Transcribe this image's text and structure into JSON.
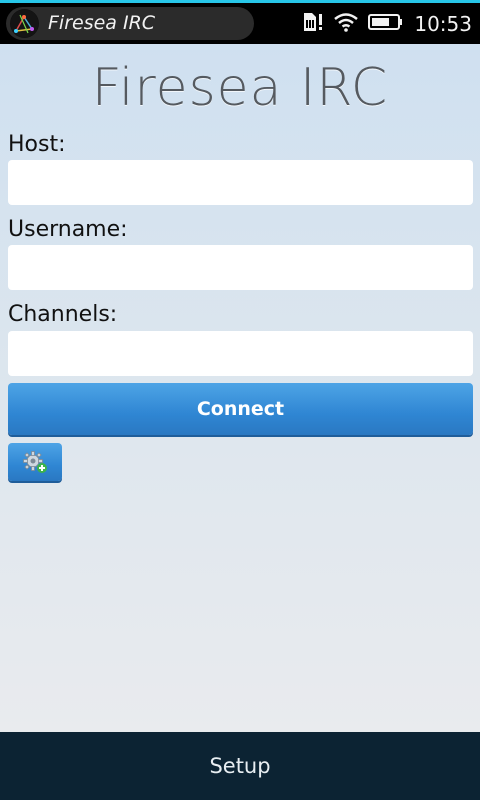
{
  "status_bar": {
    "app_title": "Firesea IRC",
    "time": "10:53",
    "icons": [
      "sim-alert-icon",
      "wifi-icon",
      "battery-icon"
    ],
    "accent_color": "#27c6e8"
  },
  "main": {
    "title": "Firesea IRC",
    "fields": [
      {
        "label": "Host:",
        "value": "",
        "placeholder": ""
      },
      {
        "label": "Username:",
        "value": "",
        "placeholder": ""
      },
      {
        "label": "Channels:",
        "value": "",
        "placeholder": ""
      }
    ],
    "connect_label": "Connect",
    "settings_icon": "gear-add-icon",
    "button_color": "#2f86d3"
  },
  "bottom_bar": {
    "label": "Setup",
    "color": "#0c2333"
  }
}
